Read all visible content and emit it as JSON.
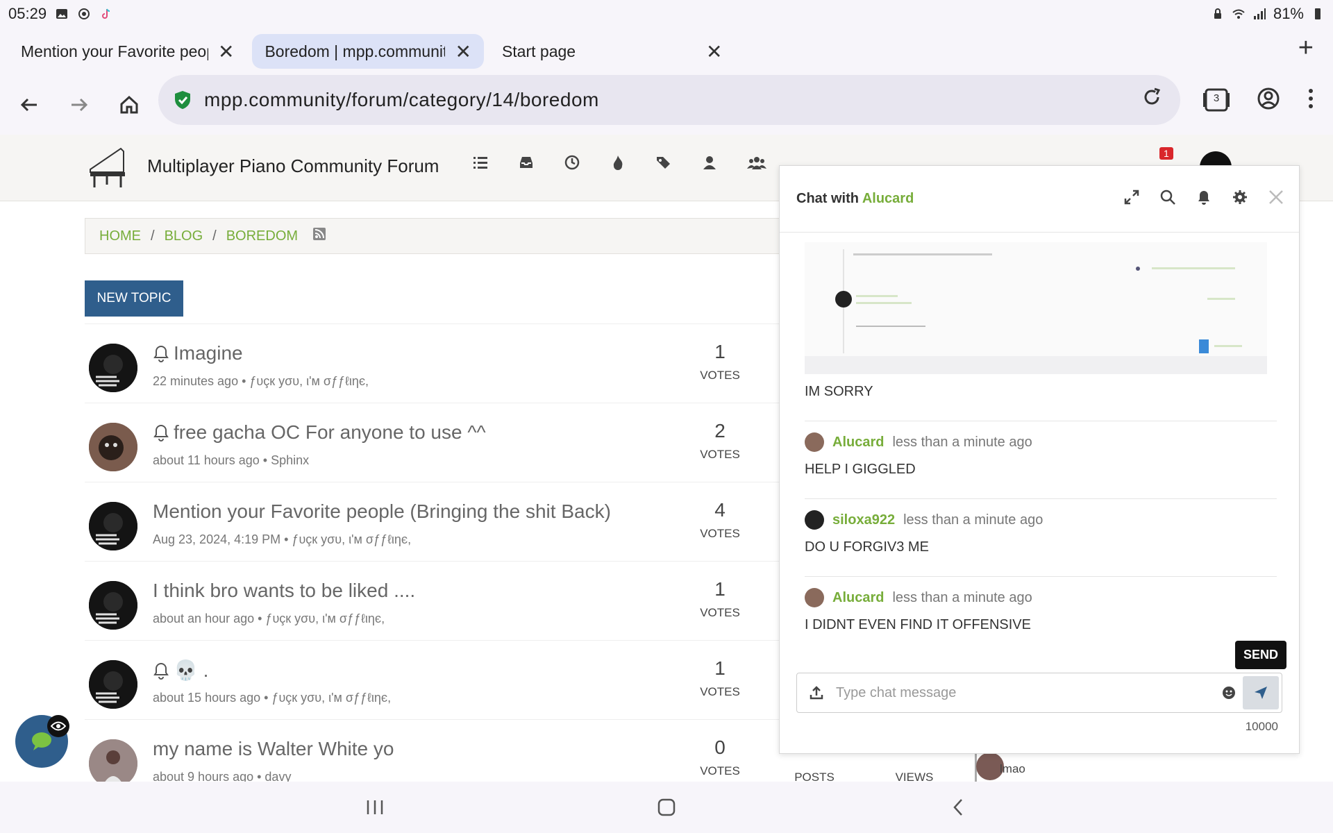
{
  "status_bar": {
    "time": "05:29",
    "battery": "81%"
  },
  "browser": {
    "tabs": [
      {
        "title": "Mention your Favorite people",
        "active": false
      },
      {
        "title": "Boredom | mpp.community",
        "active": true
      },
      {
        "title": "Start page",
        "active": false
      }
    ],
    "url": "mpp.community/forum/category/14/boredom",
    "tab_count": "3"
  },
  "forum": {
    "title": "Multiplayer Piano Community Forum",
    "notification_count": "1",
    "breadcrumb": [
      "HOME",
      "BLOG",
      "BOREDOM"
    ],
    "breadcrumb_sep": "/",
    "new_topic_label": "NEW TOPIC",
    "votes_label": "VOTES",
    "posts_label": "POSTS",
    "views_label": "VIEWS",
    "topics": [
      {
        "title": "Imagine",
        "has_bell": true,
        "meta": "22 minutes ago • ƒυçк уσυ, ι'м σƒƒℓιηє,",
        "votes": "1"
      },
      {
        "title": "free gacha OC For anyone to use ^^",
        "has_bell": true,
        "meta": "about 11 hours ago • Sphinx",
        "votes": "2"
      },
      {
        "title": "Mention your Favorite people (Bringing the shit Back)",
        "has_bell": false,
        "meta": "Aug 23, 2024, 4:19 PM • ƒυçк уσυ, ι'м σƒƒℓιηє,",
        "votes": "4"
      },
      {
        "title": "I think bro wants to be liked ....",
        "has_bell": false,
        "meta": "about an hour ago • ƒυçк уσυ, ι'м σƒƒℓιηє,",
        "votes": "1"
      },
      {
        "title": "💀 .",
        "has_bell": true,
        "meta": "about 15 hours ago • ƒυçк уσυ, ι'м σƒƒℓιηє,",
        "votes": "1"
      },
      {
        "title": "my name is Walter White yo",
        "has_bell": false,
        "meta": "about 9 hours ago • davy",
        "votes": "0"
      }
    ],
    "last_post_preview": "lmao"
  },
  "chat": {
    "title_prefix": "Chat with",
    "user": "Alucard",
    "messages": [
      {
        "text": "IM SORRY"
      },
      {
        "author": "Alucard",
        "time": "less than a minute ago",
        "text": "HELP I GIGGLED"
      },
      {
        "author": "siloxa922",
        "time": "less than a minute ago",
        "text": "DO U FORGIV3 ME"
      },
      {
        "author": "Alucard",
        "time": "less than a minute ago",
        "text": "I DIDNT EVEN FIND IT OFFENSIVE"
      }
    ],
    "send_tooltip": "SEND",
    "placeholder": "Type chat message",
    "char_limit": "10000"
  },
  "colors": {
    "accent_green": "#77ad3a",
    "primary_blue": "#2f5e8c",
    "badge_red": "#d9262b"
  }
}
